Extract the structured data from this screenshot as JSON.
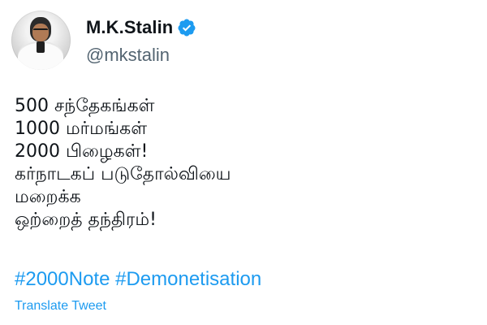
{
  "user": {
    "display_name": "M.K.Stalin",
    "handle": "@mkstalin",
    "verified_badge": "verified-badge-icon",
    "verified_color": "#1d9bf0"
  },
  "tweet": {
    "lines": [
      "500 சந்தேகங்கள்",
      "1000 மர்மங்கள்",
      "2000 பிழைகள்!",
      "கர்நாடகப் படுதோல்வியை",
      "மறைக்க",
      "ஒற்றைத் தந்திரம்!"
    ],
    "hashtags": [
      "#2000Note",
      "#Demonetisation"
    ],
    "translate_label": "Translate Tweet"
  },
  "colors": {
    "text": "#0f1419",
    "secondary": "#536471",
    "link": "#1d9bf0",
    "background": "#ffffff"
  }
}
